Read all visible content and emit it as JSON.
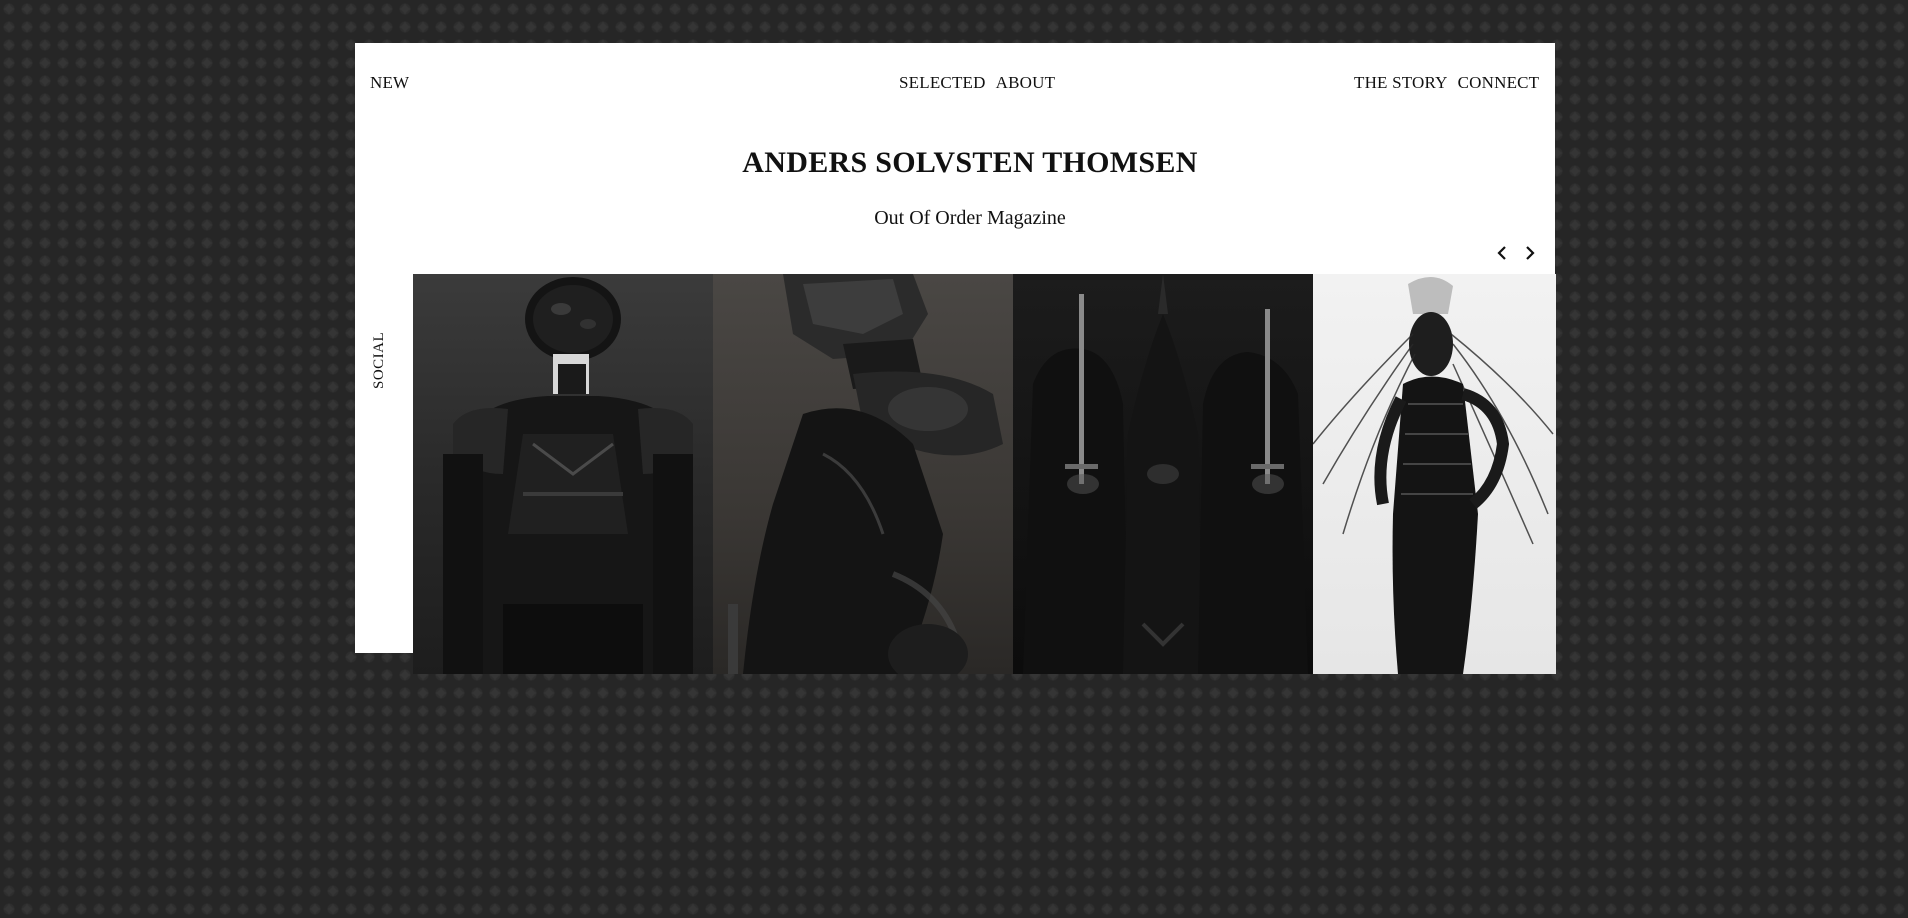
{
  "nav": {
    "left": [
      {
        "label": "NEW"
      }
    ],
    "center": [
      {
        "label": "SELECTED"
      },
      {
        "label": "ABOUT"
      }
    ],
    "right": [
      {
        "label": "THE STORY"
      },
      {
        "label": "CONNECT"
      }
    ]
  },
  "header": {
    "title": "ANDERS SOLVSTEN THOMSEN",
    "subtitle": "Out Of Order Magazine"
  },
  "sidebar": {
    "social_label": "SOCIAL"
  },
  "carousel": {
    "prev_icon": "chevron-left-icon",
    "next_icon": "chevron-right-icon",
    "photos": [
      {
        "name": "photo-masked-figure-armor"
      },
      {
        "name": "photo-armored-helmet-profile"
      },
      {
        "name": "photo-hooded-figures-swords"
      },
      {
        "name": "photo-figure-headdress-fringe"
      }
    ]
  },
  "colors": {
    "background": "#2e2e2e",
    "panel": "#ffffff",
    "text": "#111111"
  }
}
